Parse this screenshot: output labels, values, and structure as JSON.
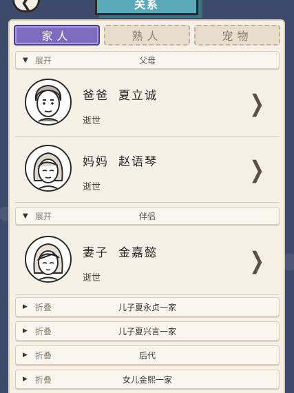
{
  "title": "关系",
  "tabs": [
    {
      "label": "家人",
      "active": true
    },
    {
      "label": "熟人",
      "active": false
    },
    {
      "label": "宠物",
      "active": false
    }
  ],
  "sections": [
    {
      "arrow": "▼",
      "state": "展开",
      "name": "父母"
    },
    {
      "arrow": "▼",
      "state": "展开",
      "name": "伴侣"
    }
  ],
  "members": [
    {
      "role": "爸爸",
      "name": "夏立诚",
      "status": "逝世"
    },
    {
      "role": "妈妈",
      "name": "赵语琴",
      "status": "逝世"
    },
    {
      "role": "妻子",
      "name": "金嘉懿",
      "status": "逝世"
    }
  ],
  "folds": [
    {
      "arrow": "▶",
      "state": "折叠",
      "name": "儿子夏永贞一家"
    },
    {
      "arrow": "▶",
      "state": "折叠",
      "name": "儿子夏兴言一家"
    },
    {
      "arrow": "▶",
      "state": "折叠",
      "name": "后代"
    },
    {
      "arrow": "▶",
      "state": "折叠",
      "name": "女儿金熙一家"
    }
  ],
  "icons": {
    "back": "chevron-left-icon",
    "chevron": "chevron-right-icon"
  },
  "colors": {
    "background": "#3d4a6b",
    "panel": "#f5f1e7",
    "active_tab": "#7c6cc0",
    "title_tab": "#5aa8b8"
  }
}
